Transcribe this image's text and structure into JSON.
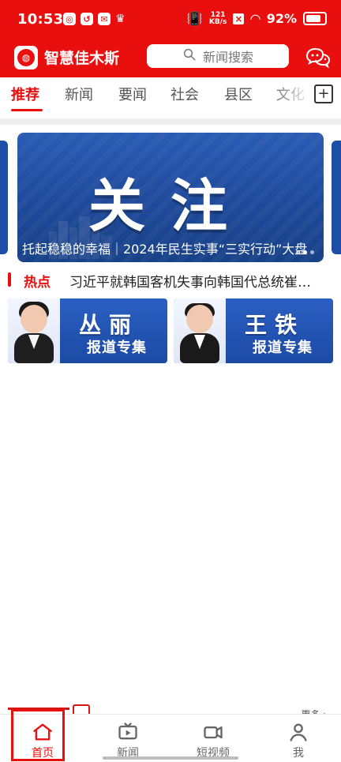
{
  "status": {
    "time": "10:53",
    "speed_value": "121",
    "speed_unit": "KB/s",
    "battery": "92%"
  },
  "header": {
    "app_title": "智慧佳木斯",
    "search_placeholder": "新闻搜索"
  },
  "tabs": [
    {
      "label": "推荐",
      "active": true
    },
    {
      "label": "新闻",
      "active": false
    },
    {
      "label": "要闻",
      "active": false
    },
    {
      "label": "社会",
      "active": false
    },
    {
      "label": "县区",
      "active": false
    },
    {
      "label": "文化",
      "active": false
    }
  ],
  "banner": {
    "headline": "关注",
    "caption": "托起稳稳的幸福｜2024年民生实事“三实行动”大盘"
  },
  "hot": {
    "label": "热点",
    "text": "习近平就韩国客机失事向韩国代总统崔…"
  },
  "cards": [
    {
      "name": "丛丽",
      "subtitle": "报道专集"
    },
    {
      "name": "王铁",
      "subtitle": "报道专集"
    }
  ],
  "more": {
    "label": "更多 ›"
  },
  "bottom_nav": [
    {
      "label": "首页",
      "active": true
    },
    {
      "label": "新闻",
      "active": false
    },
    {
      "label": "短视频",
      "active": false
    },
    {
      "label": "我",
      "active": false
    }
  ],
  "colors": {
    "brand_red": "#e90f0f",
    "banner_blue": "#1f4a9b"
  }
}
